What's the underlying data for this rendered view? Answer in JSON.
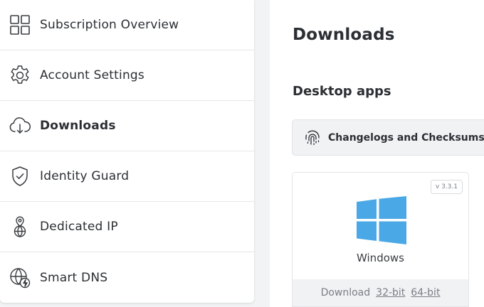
{
  "sidebar": {
    "items": [
      {
        "label": "Subscription Overview",
        "icon": "grid-icon"
      },
      {
        "label": "Account Settings",
        "icon": "gear-icon"
      },
      {
        "label": "Downloads",
        "icon": "cloud-download-icon"
      },
      {
        "label": "Identity Guard",
        "icon": "shield-check-icon"
      },
      {
        "label": "Dedicated IP",
        "icon": "location-globe-icon"
      },
      {
        "label": "Smart DNS",
        "icon": "globe-bolt-icon"
      }
    ],
    "active_index": 2
  },
  "main": {
    "title": "Downloads",
    "section_title": "Desktop apps",
    "changelog_button": {
      "label": "Changelogs and Checksums",
      "icon": "fingerprint-icon"
    },
    "app_card": {
      "version": "v 3.3.1",
      "name": "Windows",
      "icon": "windows-logo-icon",
      "download_label": "Download",
      "link_32": "32-bit",
      "link_64": "64-bit"
    }
  },
  "colors": {
    "windows_blue": "#4aa8e6",
    "background": "#f2f3f5",
    "text": "#2b2e33"
  }
}
